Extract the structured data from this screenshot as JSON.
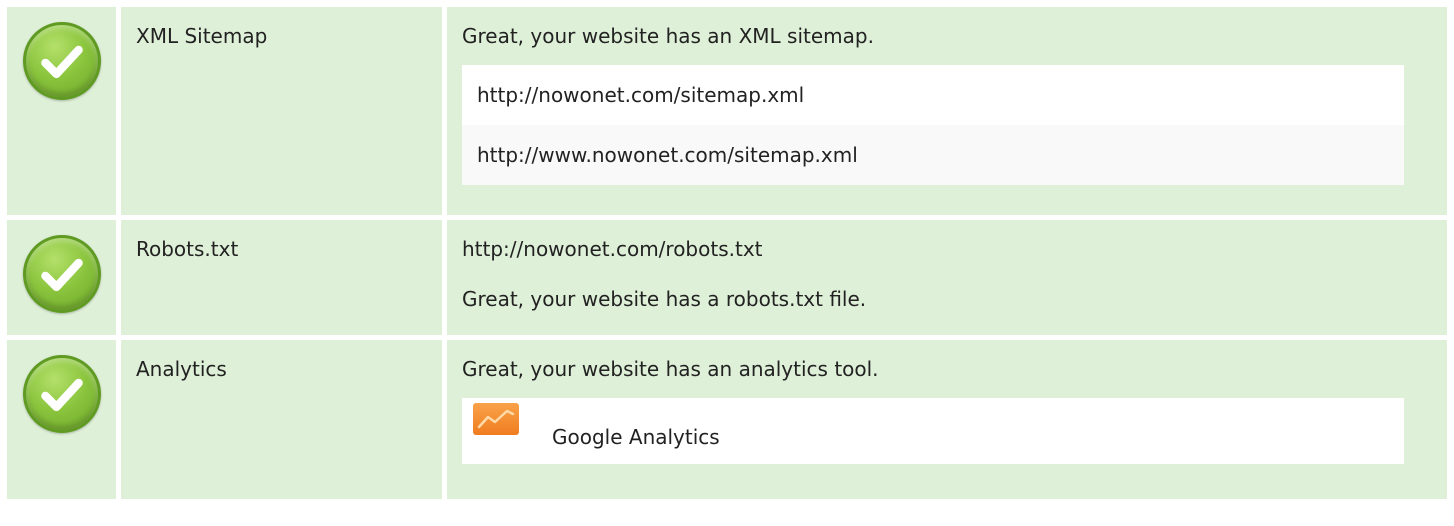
{
  "checks": {
    "sitemap": {
      "name": "XML Sitemap",
      "message": "Great, your website has an XML sitemap.",
      "urls": [
        "http://nowonet.com/sitemap.xml",
        "http://www.nowonet.com/sitemap.xml"
      ],
      "icon": "check-icon",
      "status_color": "#8cc63f"
    },
    "robots": {
      "name": "Robots.txt",
      "url": "http://nowonet.com/robots.txt",
      "message": "Great, your website has a robots.txt file.",
      "icon": "check-icon",
      "status_color": "#8cc63f"
    },
    "analytics": {
      "name": "Analytics",
      "message": "Great, your website has an analytics tool.",
      "tool_name": "Google Analytics",
      "tool_icon": "google-analytics-icon",
      "icon": "check-icon",
      "status_color": "#8cc63f"
    }
  },
  "colors": {
    "row_background": "#dff0d8",
    "box_background": "#ffffff",
    "box_alt_background": "#f9f9f9"
  }
}
